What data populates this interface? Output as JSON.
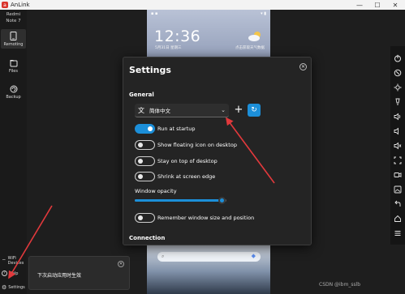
{
  "window": {
    "app_title": "AnLink",
    "minimize": "—",
    "maximize": "☐",
    "close": "✕"
  },
  "sidebar": {
    "device_name_line1": "Redmi",
    "device_name_line2": "Note 7",
    "items": [
      {
        "label": "Remoting",
        "icon": "phone-icon",
        "active": true
      },
      {
        "label": "Files",
        "icon": "files-icon",
        "active": false
      },
      {
        "label": "Backup",
        "icon": "backup-icon",
        "active": false
      }
    ],
    "bottom": [
      {
        "label": "WiFi",
        "label2": "Devices",
        "icon": "wifi-icon"
      },
      {
        "label": "Help",
        "icon": "help-icon"
      },
      {
        "label": "Settings",
        "icon": "settings-icon"
      }
    ]
  },
  "phone": {
    "clock": "12:36",
    "date": "5月31日 星期三",
    "weather": "点击获取天气数据"
  },
  "settings": {
    "title": "Settings",
    "general_heading": "General",
    "language_value": "简体中文",
    "toggles": [
      {
        "label": "Run at startup",
        "on": true
      },
      {
        "label": "Show floating icon on desktop",
        "on": false
      },
      {
        "label": "Stay on top of desktop",
        "on": false
      },
      {
        "label": "Shrink at screen edge",
        "on": false
      }
    ],
    "window_opacity_label": "Window opacity",
    "window_opacity_level": 0.95,
    "remember_label": "Remember window size and position",
    "remember_on": false,
    "connection_heading": "Connection"
  },
  "toast": {
    "message": "下次启动应用时生效"
  },
  "watermark": "CSDN @ibm_sslb",
  "colors": {
    "accent": "#1c8fd9",
    "dialog_bg": "#242424",
    "arrow": "#e2393c"
  }
}
